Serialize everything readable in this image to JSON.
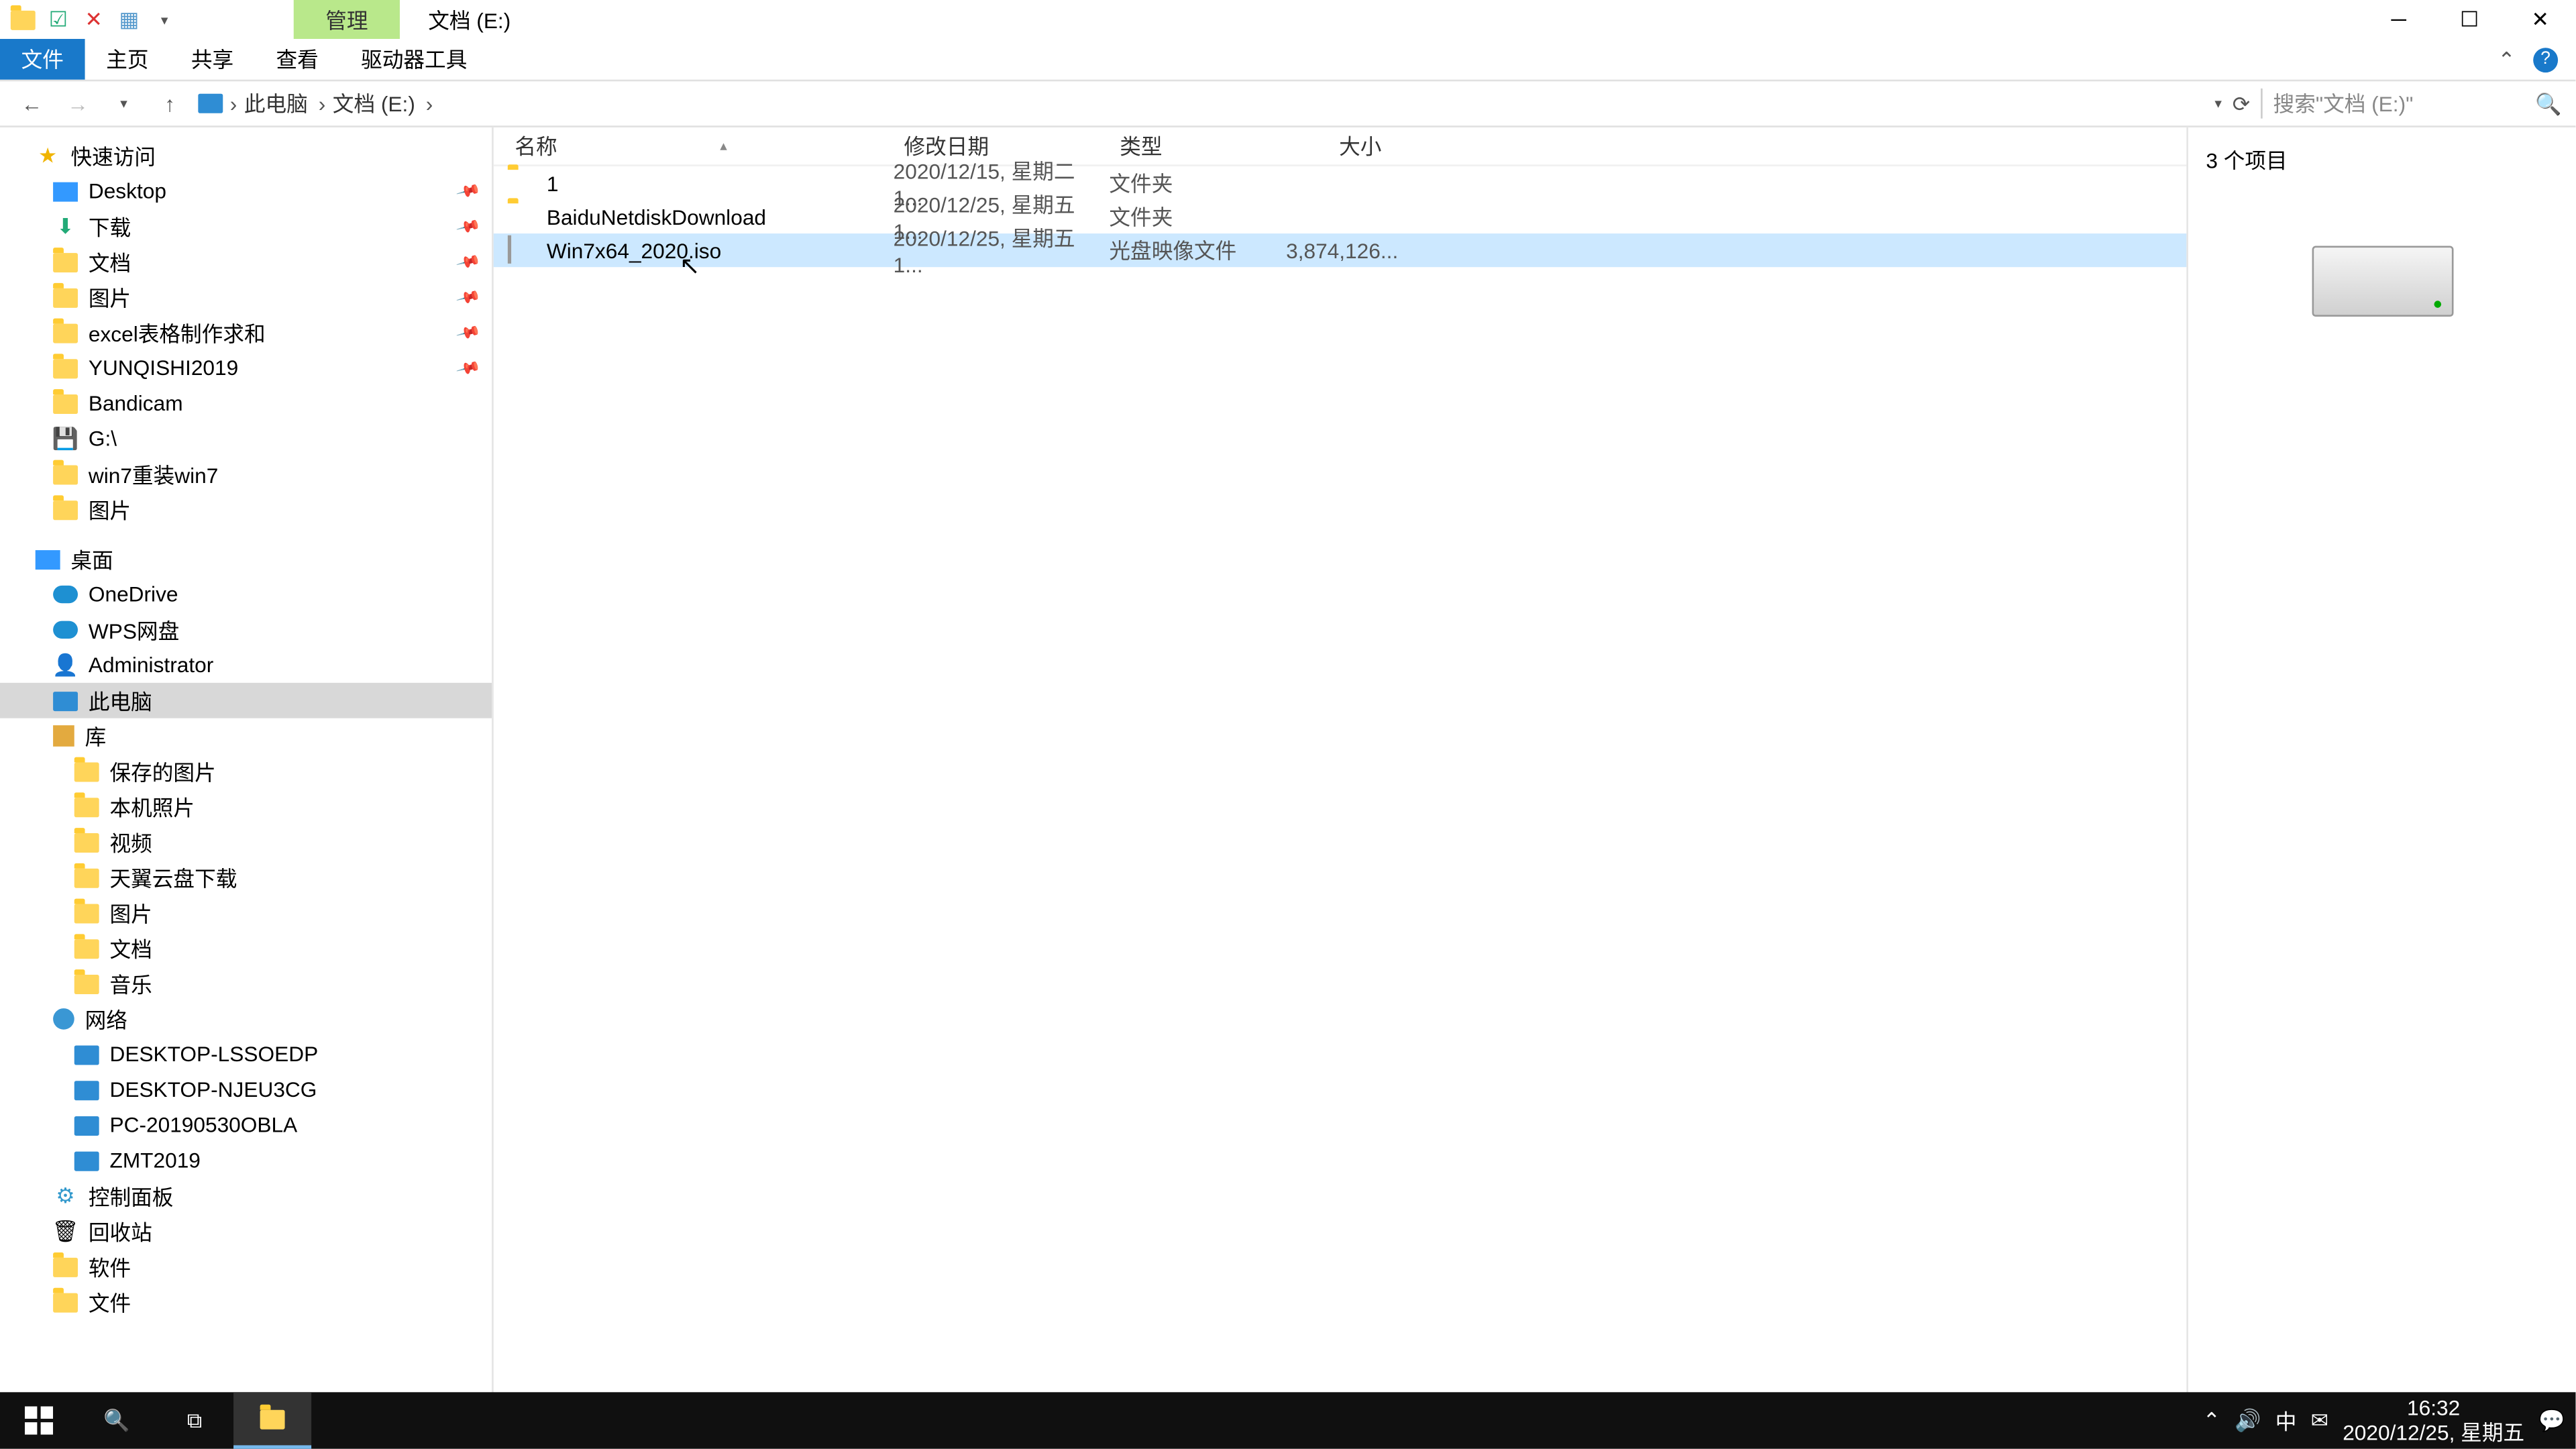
{
  "title": "文档 (E:)",
  "context_tab": "管理",
  "ribbon": {
    "file": "文件",
    "home": "主页",
    "share": "共享",
    "view": "查看",
    "drive_tools": "驱动器工具"
  },
  "breadcrumb": [
    "此电脑",
    "文档 (E:)"
  ],
  "search_placeholder": "搜索\"文档 (E:)\"",
  "columns": {
    "name": "名称",
    "date": "修改日期",
    "type": "类型",
    "size": "大小"
  },
  "rows": [
    {
      "name": "1",
      "date": "2020/12/15, 星期二 1...",
      "type": "文件夹",
      "size": "",
      "icon": "folder",
      "selected": false
    },
    {
      "name": "BaiduNetdiskDownload",
      "date": "2020/12/25, 星期五 1...",
      "type": "文件夹",
      "size": "",
      "icon": "folder",
      "selected": false
    },
    {
      "name": "Win7x64_2020.iso",
      "date": "2020/12/25, 星期五 1...",
      "type": "光盘映像文件",
      "size": "3,874,126...",
      "icon": "file",
      "selected": true
    }
  ],
  "nav": {
    "quick_access": "快速访问",
    "quick_items": [
      "Desktop",
      "下载",
      "文档",
      "图片",
      "excel表格制作求和",
      "YUNQISHI2019",
      "Bandicam",
      "G:\\",
      "win7重装win7",
      "图片"
    ],
    "desktop": "桌面",
    "desktop_items": [
      "OneDrive",
      "WPS网盘",
      "Administrator",
      "此电脑",
      "库"
    ],
    "library_items": [
      "保存的图片",
      "本机照片",
      "视频",
      "天翼云盘下载",
      "图片",
      "文档",
      "音乐"
    ],
    "network": "网络",
    "network_items": [
      "DESKTOP-LSSOEDP",
      "DESKTOP-NJEU3CG",
      "PC-20190530OBLA",
      "ZMT2019"
    ],
    "control_panel": "控制面板",
    "recycle": "回收站",
    "software": "软件",
    "docs": "文件"
  },
  "preview": {
    "count_label": "3 个项目"
  },
  "status": {
    "text": "3 个项目"
  },
  "tray": {
    "ime": "中",
    "time": "16:32",
    "date": "2020/12/25, 星期五"
  }
}
